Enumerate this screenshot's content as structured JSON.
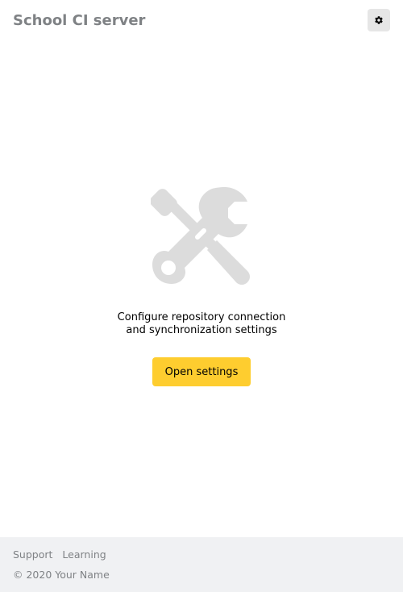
{
  "header": {
    "title": "School CI server",
    "settings_icon": "gear-icon"
  },
  "main": {
    "illustration_icon": "tools-icon",
    "message_line1": "Configure repository connection",
    "message_line2": "and synchronization settings",
    "open_settings_label": "Open settings"
  },
  "footer": {
    "links": [
      {
        "label": "Support"
      },
      {
        "label": "Learning"
      }
    ],
    "copyright": "© 2020 Your Name"
  },
  "colors": {
    "accent": "#fecd2f",
    "muted_text": "#7f8285",
    "footer_bg": "#f0f1f3",
    "icon_gray": "#dcdcdc"
  }
}
